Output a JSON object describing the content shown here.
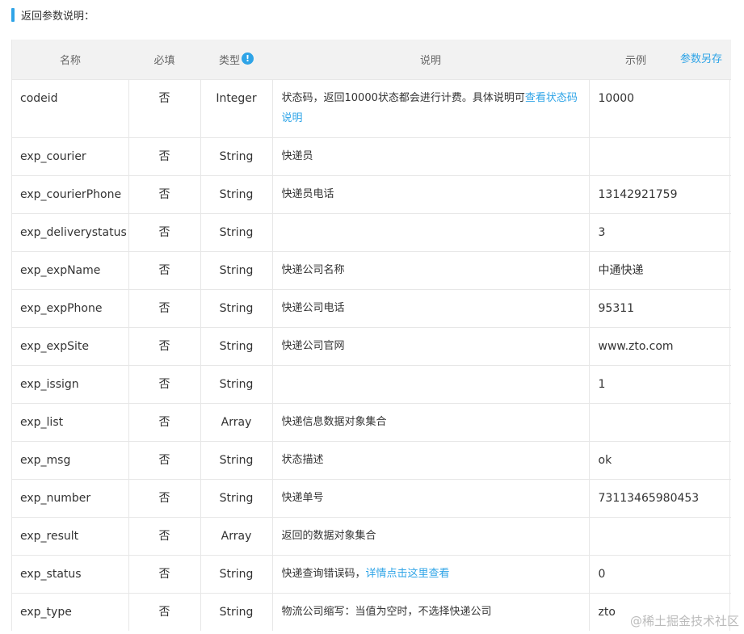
{
  "section": {
    "title": "返回参数说明："
  },
  "table": {
    "headers": {
      "name": "名称",
      "required": "必填",
      "type": "类型",
      "type_icon": "!",
      "desc": "说明",
      "example": "示例",
      "save_link": "参数另存"
    },
    "rows": [
      {
        "name": "codeid",
        "required": "否",
        "type": "Integer",
        "desc": "状态码，返回10000状态都会进行计费。具体说明可",
        "desc_link": "查看状态码说明",
        "example": "10000"
      },
      {
        "name": "exp_courier",
        "required": "否",
        "type": "String",
        "desc": "快递员",
        "desc_link": "",
        "example": ""
      },
      {
        "name": "exp_courierPhone",
        "required": "否",
        "type": "String",
        "desc": "快递员电话",
        "desc_link": "",
        "example": "13142921759"
      },
      {
        "name": "exp_deliverystatus",
        "required": "否",
        "type": "String",
        "desc": "",
        "desc_link": "",
        "example": "3"
      },
      {
        "name": "exp_expName",
        "required": "否",
        "type": "String",
        "desc": "快递公司名称",
        "desc_link": "",
        "example": "中通快递"
      },
      {
        "name": "exp_expPhone",
        "required": "否",
        "type": "String",
        "desc": "快递公司电话",
        "desc_link": "",
        "example": "95311"
      },
      {
        "name": "exp_expSite",
        "required": "否",
        "type": "String",
        "desc": "快递公司官网",
        "desc_link": "",
        "example": "www.zto.com"
      },
      {
        "name": "exp_issign",
        "required": "否",
        "type": "String",
        "desc": "",
        "desc_link": "",
        "example": "1"
      },
      {
        "name": "exp_list",
        "required": "否",
        "type": "Array",
        "desc": "快递信息数据对象集合",
        "desc_link": "",
        "example": ""
      },
      {
        "name": "exp_msg",
        "required": "否",
        "type": "String",
        "desc": "状态描述",
        "desc_link": "",
        "example": "ok"
      },
      {
        "name": "exp_number",
        "required": "否",
        "type": "String",
        "desc": "快递单号",
        "desc_link": "",
        "example": "73113465980453"
      },
      {
        "name": "exp_result",
        "required": "否",
        "type": "Array",
        "desc": "返回的数据对象集合",
        "desc_link": "",
        "example": ""
      },
      {
        "name": "exp_status",
        "required": "否",
        "type": "String",
        "desc": "快递查询错误码，",
        "desc_link": "详情点击这里查看",
        "example": "0"
      },
      {
        "name": "exp_type",
        "required": "否",
        "type": "String",
        "desc": "物流公司缩写：当值为空时，不选择快递公司",
        "desc_link": "",
        "example": "zto"
      }
    ]
  },
  "watermark": "@稀土掘金技术社区"
}
